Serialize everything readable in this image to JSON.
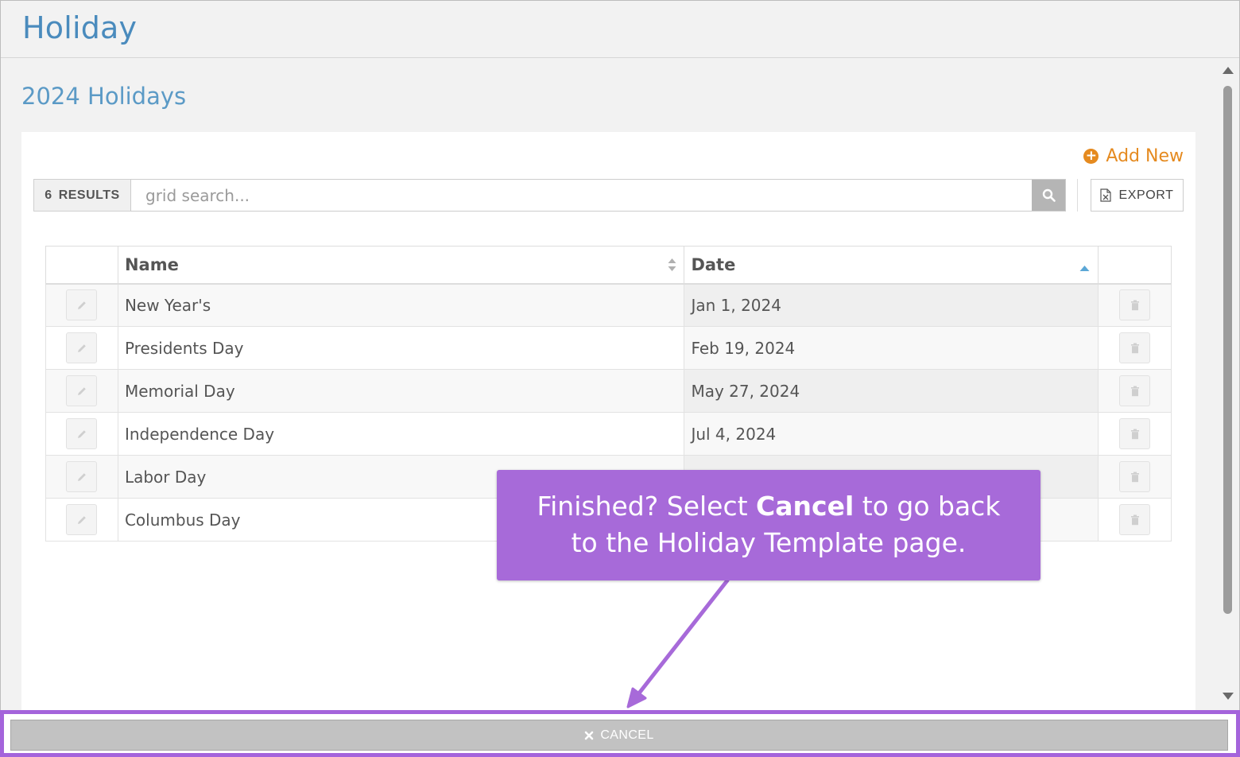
{
  "header": {
    "title": "Holiday"
  },
  "section": {
    "title": "2024 Holidays"
  },
  "toolbar": {
    "add_new_label": "Add New",
    "results_count": "6",
    "results_label": "RESULTS",
    "search_placeholder": "grid search...",
    "search_value": "",
    "export_label": "EXPORT"
  },
  "grid": {
    "columns": [
      "Name",
      "Date"
    ],
    "rows": [
      {
        "name": "New Year's",
        "date": "Jan 1, 2024"
      },
      {
        "name": "Presidents Day",
        "date": "Feb 19, 2024"
      },
      {
        "name": "Memorial Day",
        "date": "May 27, 2024"
      },
      {
        "name": "Independence Day",
        "date": "Jul 4, 2024"
      },
      {
        "name": "Labor Day",
        "date": ""
      },
      {
        "name": "Columbus Day",
        "date": ""
      }
    ]
  },
  "callout": {
    "text_before": "Finished? Select ",
    "text_bold": "Cancel",
    "text_after_line1": " to go back",
    "text_line2": "to the Holiday Template page."
  },
  "footer": {
    "cancel_label": "CANCEL"
  },
  "colors": {
    "accent_blue": "#4a8bbd",
    "accent_orange": "#e58a1f",
    "callout_purple": "#a76ad9"
  }
}
